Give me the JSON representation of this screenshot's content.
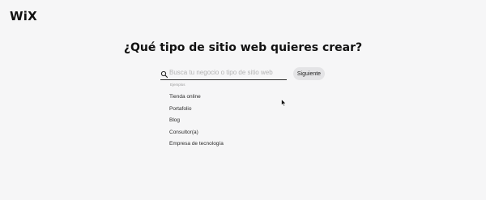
{
  "brand": {
    "logo_text": "WiX"
  },
  "page": {
    "title": "¿Qué tipo de sitio web quieres crear?"
  },
  "search": {
    "icon": "search-icon",
    "placeholder": "Busca tu negocio o tipo de sitio web",
    "value": ""
  },
  "actions": {
    "next_label": "Siguiente"
  },
  "examples": {
    "label": "Ejemplos",
    "items": [
      {
        "label": "Tienda online"
      },
      {
        "label": "Portafolio"
      },
      {
        "label": "Blog"
      },
      {
        "label": "Consultor(a)"
      },
      {
        "label": "Empresa de tecnología"
      }
    ]
  },
  "colors": {
    "background": "#f6f6f7",
    "button_bg": "#e4e4e6",
    "text": "#1a1a1a",
    "placeholder": "#b3b3b3"
  }
}
